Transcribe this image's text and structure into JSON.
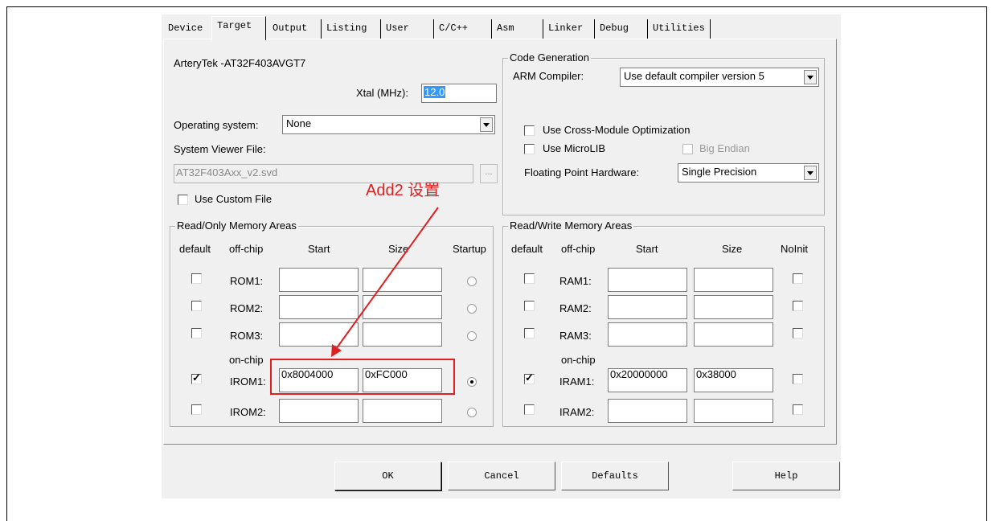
{
  "tabs": [
    "Device",
    "Target",
    "Output",
    "Listing",
    "User",
    "C/C++",
    "Asm",
    "Linker",
    "Debug",
    "Utilities"
  ],
  "device_name": "ArteryTek -AT32F403AVGT7",
  "xtal": {
    "label": "Xtal (MHz):",
    "value": "12.0"
  },
  "os": {
    "label": "Operating system:",
    "value": "None"
  },
  "svd": {
    "label": "System Viewer File:",
    "value": "AT32F403Axx_v2.svd",
    "browse": "...",
    "custom_label": "Use Custom File"
  },
  "codegen": {
    "title": "Code Generation",
    "compiler_label": "ARM Compiler:",
    "compiler_value": "Use default compiler version 5",
    "cross_module": "Use Cross-Module Optimization",
    "microlib": "Use MicroLIB",
    "big_endian": "Big Endian",
    "fpu_label": "Floating Point Hardware:",
    "fpu_value": "Single Precision"
  },
  "rom": {
    "title": "Read/Only Memory Areas",
    "headers": {
      "default": "default",
      "offchip": "off-chip",
      "start": "Start",
      "size": "Size",
      "startup": "Startup"
    },
    "onchip": "on-chip",
    "rows": [
      {
        "name": "ROM1:",
        "start": "",
        "size": "",
        "default": false,
        "startup": false
      },
      {
        "name": "ROM2:",
        "start": "",
        "size": "",
        "default": false,
        "startup": false
      },
      {
        "name": "ROM3:",
        "start": "",
        "size": "",
        "default": false,
        "startup": false
      },
      {
        "name": "IROM1:",
        "start": "0x8004000",
        "size": "0xFC000",
        "default": true,
        "startup": true
      },
      {
        "name": "IROM2:",
        "start": "",
        "size": "",
        "default": false,
        "startup": false
      }
    ]
  },
  "ram": {
    "title": "Read/Write Memory Areas",
    "headers": {
      "default": "default",
      "offchip": "off-chip",
      "start": "Start",
      "size": "Size",
      "noinit": "NoInit"
    },
    "onchip": "on-chip",
    "rows": [
      {
        "name": "RAM1:",
        "start": "",
        "size": "",
        "default": false,
        "noinit": false
      },
      {
        "name": "RAM2:",
        "start": "",
        "size": "",
        "default": false,
        "noinit": false
      },
      {
        "name": "RAM3:",
        "start": "",
        "size": "",
        "default": false,
        "noinit": false
      },
      {
        "name": "IRAM1:",
        "start": "0x20000000",
        "size": "0x38000",
        "default": true,
        "noinit": false
      },
      {
        "name": "IRAM2:",
        "start": "",
        "size": "",
        "default": false,
        "noinit": false
      }
    ]
  },
  "buttons": {
    "ok": "OK",
    "cancel": "Cancel",
    "defaults": "Defaults",
    "help": "Help"
  },
  "annotation": {
    "text": "Add2 设置",
    "color": "#e02020"
  }
}
